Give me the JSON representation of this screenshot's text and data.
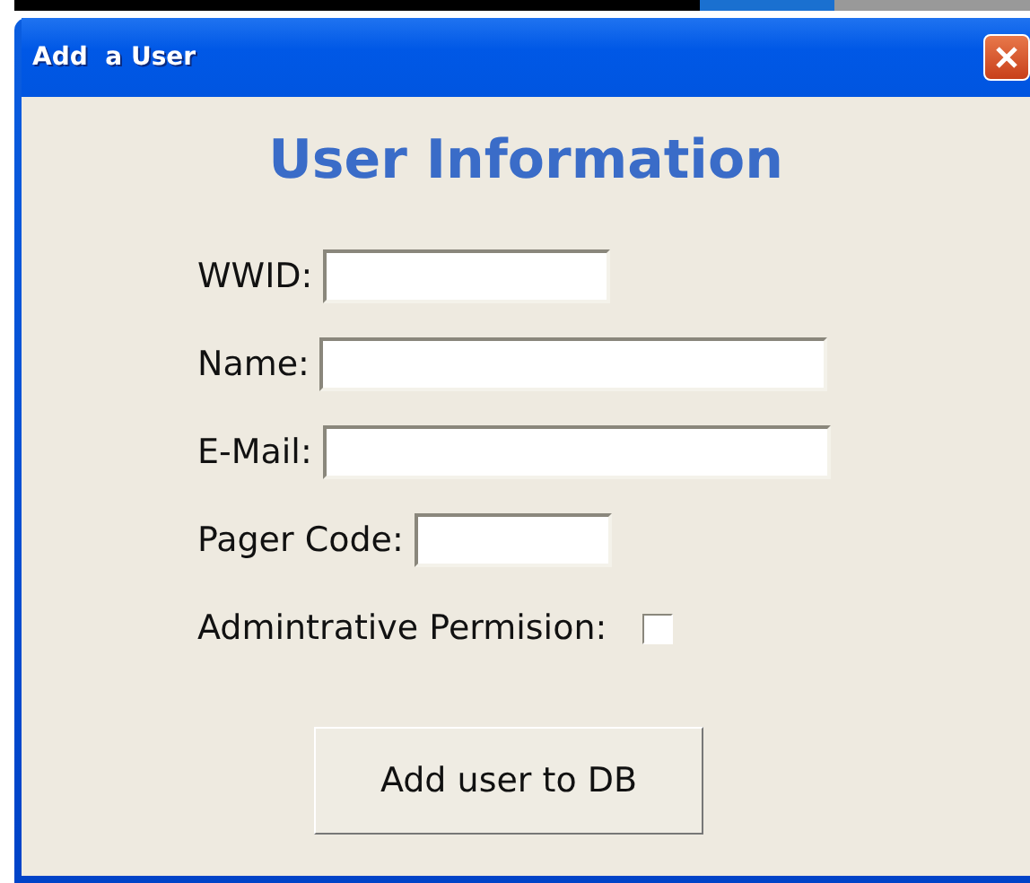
{
  "window": {
    "title": "Add  a User"
  },
  "heading": "User Information",
  "fields": [
    {
      "label": "WWID:"
    },
    {
      "label": "Name:"
    },
    {
      "label": "E-Mail:"
    },
    {
      "label": "Pager Code:"
    }
  ],
  "permission": {
    "label": "Admintrative Permision:",
    "checked": false
  },
  "submit": {
    "label": "Add user to DB"
  }
}
